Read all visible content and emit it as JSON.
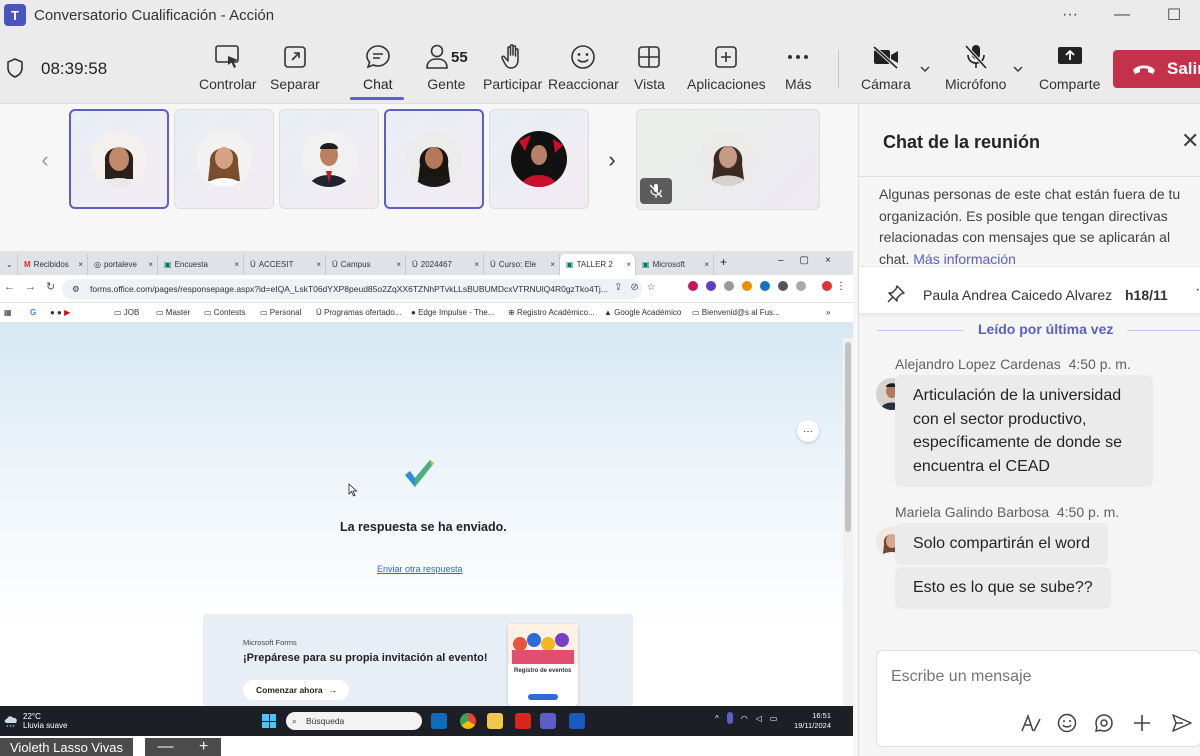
{
  "window": {
    "title": "Conversatorio Cualificación - Acción",
    "more": "···"
  },
  "meeting": {
    "timer": "08:39:58",
    "people_count": "55"
  },
  "toolbar": {
    "controlar": "Controlar",
    "separar": "Separar",
    "chat": "Chat",
    "gente": "Gente",
    "participar": "Participar",
    "reaccionar": "Reaccionar",
    "vista": "Vista",
    "aplicaciones": "Aplicaciones",
    "mas": "Más",
    "camara": "Cámara",
    "microfono": "Micrófono",
    "comparte": "Comparte",
    "salir": "Salir"
  },
  "browser": {
    "tabs": [
      "Recibidos",
      "portaleve",
      "Encuesta",
      "ACCESIT",
      "Campus",
      "2024467",
      "Curso: Ele",
      "TALLER 2",
      "Microsoft"
    ],
    "url": "forms.office.com/pages/responsepage.aspx?id=eIQA_LskT06dYXP8peud85o2ZqXX6TZNhPTvkLLsBUBUMDcxVTRNUlQ4R0gzTko4Tj...",
    "bookmarks": [
      "G",
      "JOB",
      "Master",
      "Contests",
      "Personal",
      "Programas ofertado...",
      "Edge Impulse - The...",
      "Registro Académico...",
      "Google Académico",
      "Bienvenid@s al Fus..."
    ]
  },
  "forms_page": {
    "confirmation": "La respuesta se ha enviado.",
    "another_link": "Enviar otra respuesta",
    "promo_brand": "Microsoft Forms",
    "promo_title": "¡Prepárese para su propia invitación al evento!",
    "promo_button": "Comenzar ahora",
    "promo_card": "Registro de eventos",
    "more": "···"
  },
  "taskbar": {
    "temp": "22°C",
    "weather": "Lluvia suave",
    "search": "Búsqueda",
    "time": "16:51",
    "date": "19/11/2024"
  },
  "presenter": {
    "name": "Violeth Lasso Vivas",
    "zoom_out": "—",
    "zoom_in": "+"
  },
  "chat": {
    "title": "Chat de la reunión",
    "notice": "Algunas personas de este chat están fuera de tu organización. Es posible que tengan directivas relacionadas con mensajes que se aplicarán al chat.",
    "notice_link": "Más información",
    "pinned_name": "Paula Andrea Caicedo Alvarez",
    "pinned_date": "h18/11",
    "read_label": "Leído por última vez",
    "messages": [
      {
        "author": "Alejandro Lopez Cardenas",
        "time": "4:50 p. m.",
        "text": "Articulación de la universidad con el sector productivo, específicamente de donde se encuentra el CEAD"
      },
      {
        "author": "Mariela Galindo Barbosa",
        "time": "4:50 p. m.",
        "text": "Solo compartirán el word"
      },
      {
        "author": "",
        "time": "",
        "text": "Esto es lo que se sube??"
      }
    ],
    "composer_placeholder": "Escribe un mensaje"
  },
  "colors": {
    "accent": "#5b5fc7",
    "leave": "#c4314b"
  }
}
